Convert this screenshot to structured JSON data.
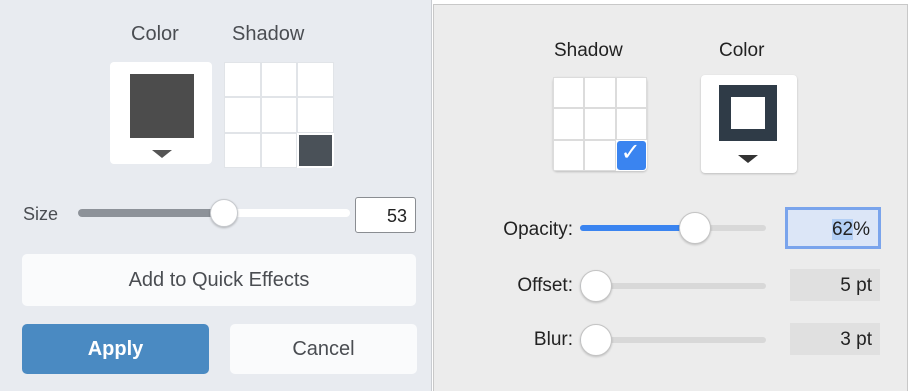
{
  "left_panel": {
    "color_label": "Color",
    "shadow_label": "Shadow",
    "color_swatch_hex": "#4c4c4c",
    "shadow_grid_selected": "bottom-right",
    "size": {
      "label": "Size",
      "value": "53",
      "slider_fraction": 0.53
    },
    "quick_effects_label": "Add to Quick Effects",
    "apply_label": "Apply",
    "cancel_label": "Cancel",
    "accent_color": "#4a8ac2"
  },
  "right_panel": {
    "shadow_label": "Shadow",
    "color_label": "Color",
    "shadow_grid_selected": "bottom-right",
    "color_swatch_hex": "#2f3b47",
    "accent_color": "#3a84f0",
    "opacity": {
      "label": "Opacity:",
      "value_num": "62",
      "value_unit": "%",
      "slider_fraction": 0.62
    },
    "offset": {
      "label": "Offset:",
      "value": "5 pt",
      "slider_fraction": 0.0
    },
    "blur": {
      "label": "Blur:",
      "value": "3 pt",
      "slider_fraction": 0.0
    }
  }
}
